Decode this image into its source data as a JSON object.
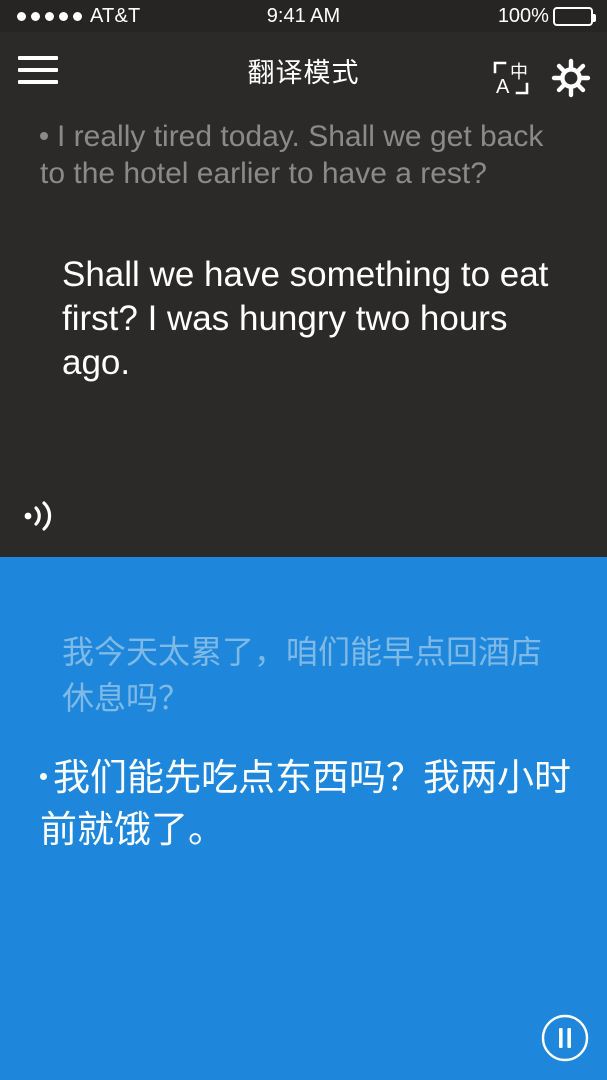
{
  "colors": {
    "dark_bg": "#2b2a29",
    "status_bg": "#262524",
    "accent_blue": "#1e87db",
    "muted_gray_text": "#8a8a8a",
    "muted_blue_text": "#7fb9e6",
    "white": "#ffffff"
  },
  "status_bar": {
    "signal_dots": 5,
    "carrier": "AT&T",
    "time": "9:41 AM",
    "battery_percent": "100%",
    "battery_level": 100,
    "battery_icon": "battery-full-icon"
  },
  "header": {
    "menu_icon": "hamburger-menu-icon",
    "title": "翻译模式",
    "translate_icon": "translate-language-icon",
    "translate_icon_source_label": "A",
    "translate_icon_target_label": "中",
    "settings_icon": "gear-icon"
  },
  "source_panel": {
    "language": "English",
    "previous_message": "I really tired today. Shall we get back to the hotel earlier to have a rest?",
    "current_message": "Shall we have something to eat first? I was hungry two hours ago.",
    "speaker_icon": "speaker-sound-wave-icon"
  },
  "target_panel": {
    "language": "中文",
    "previous_message": "我今天太累了，咱们能早点回酒店休息吗？",
    "current_message": "我们能先吃点东西吗？我两小时前就饿了。",
    "pause_icon": "pause-circle-icon"
  }
}
